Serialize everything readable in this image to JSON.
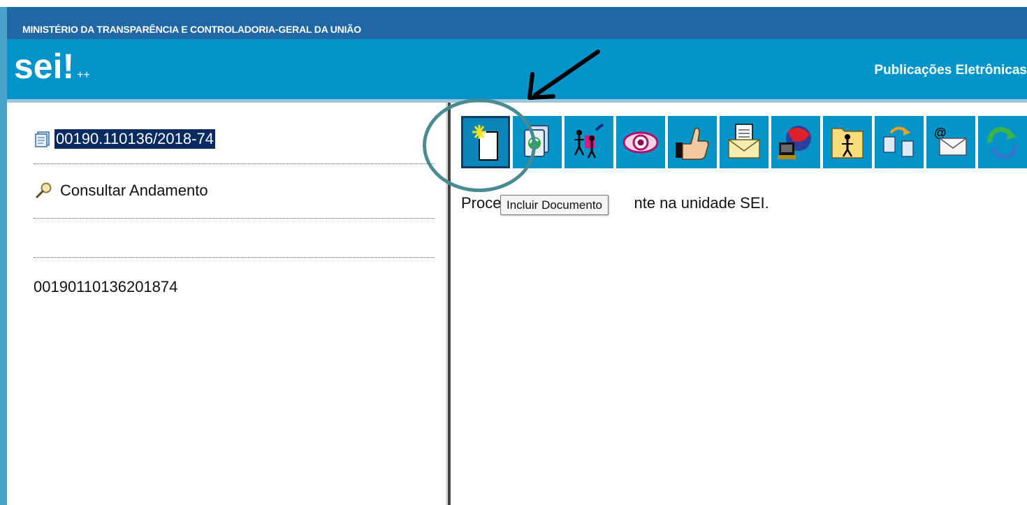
{
  "header": {
    "ministry": "MINISTÉRIO DA TRANSPARÊNCIA E CONTROLADORIA-GERAL DA UNIÃO",
    "logo_text": "sei!",
    "logo_suffix": "++",
    "system_title": "Publicações Eletrônicas"
  },
  "sidebar": {
    "process_number": "00190.110136/2018-74",
    "consult_label": "Consultar Andamento",
    "barcode_text": "00190110136201874"
  },
  "toolbar": {
    "buttons": [
      {
        "icon": "new-document-icon",
        "tooltip": "Incluir Documento"
      },
      {
        "icon": "related-process-icon"
      },
      {
        "icon": "assign-users-icon"
      },
      {
        "icon": "view-eye-icon"
      },
      {
        "icon": "thumbs-up-icon"
      },
      {
        "icon": "send-document-icon"
      },
      {
        "icon": "network-globe-icon"
      },
      {
        "icon": "folder-person-icon"
      },
      {
        "icon": "move-documents-icon"
      },
      {
        "icon": "email-icon"
      },
      {
        "icon": "refresh-icon"
      }
    ],
    "tooltip_text": "Incluir Documento"
  },
  "main": {
    "status_text_start": "Proce",
    "status_text_end": "nte na unidade SEI."
  },
  "colors": {
    "header_bar": "#0395c9",
    "ministry_bar": "#2067a5",
    "selected_bg": "#0a2a62",
    "annotation_circle": "#4a8b93"
  }
}
